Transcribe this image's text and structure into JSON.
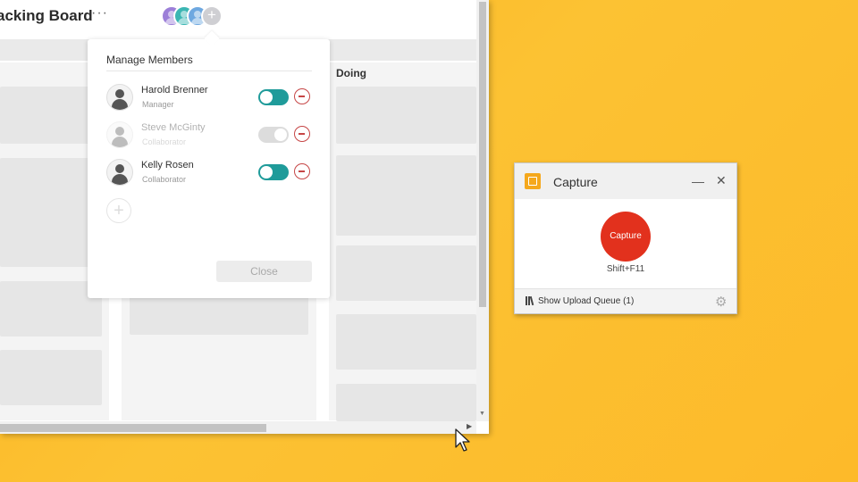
{
  "board": {
    "title": "acking Board",
    "more_label": "···",
    "add_member_label": "+",
    "column_doing": "Doing",
    "scroll_down_arrow": "▼",
    "scroll_right_arrow": "▶"
  },
  "members_popover": {
    "title": "Manage Members",
    "members": [
      {
        "name": "Harold Brenner",
        "role": "Manager",
        "enabled": true
      },
      {
        "name": "Steve McGinty",
        "role": "Collaborator",
        "enabled": false
      },
      {
        "name": "Kelly Rosen",
        "role": "Collaborator",
        "enabled": true
      }
    ],
    "add_label": "+",
    "close_label": "Close"
  },
  "capture_window": {
    "title": "Capture",
    "minimize_label": "—",
    "close_label": "✕",
    "capture_button_label": "Capture",
    "hotkey": "Shift+F11",
    "upload_queue_label": "Show Upload Queue (1)",
    "settings_icon": "⚙"
  },
  "colors": {
    "background": "#fcc233",
    "toggle_on": "#1f9b9a",
    "remove_red": "#c64646",
    "capture_red": "#e2311d",
    "capture_logo": "#f5a81c"
  },
  "icons": {
    "avatar": "person-icon",
    "remove": "minus-circle-icon",
    "settings": "gear-icon",
    "upload_queue": "library-icon",
    "cursor": "mouse-pointer-icon"
  }
}
